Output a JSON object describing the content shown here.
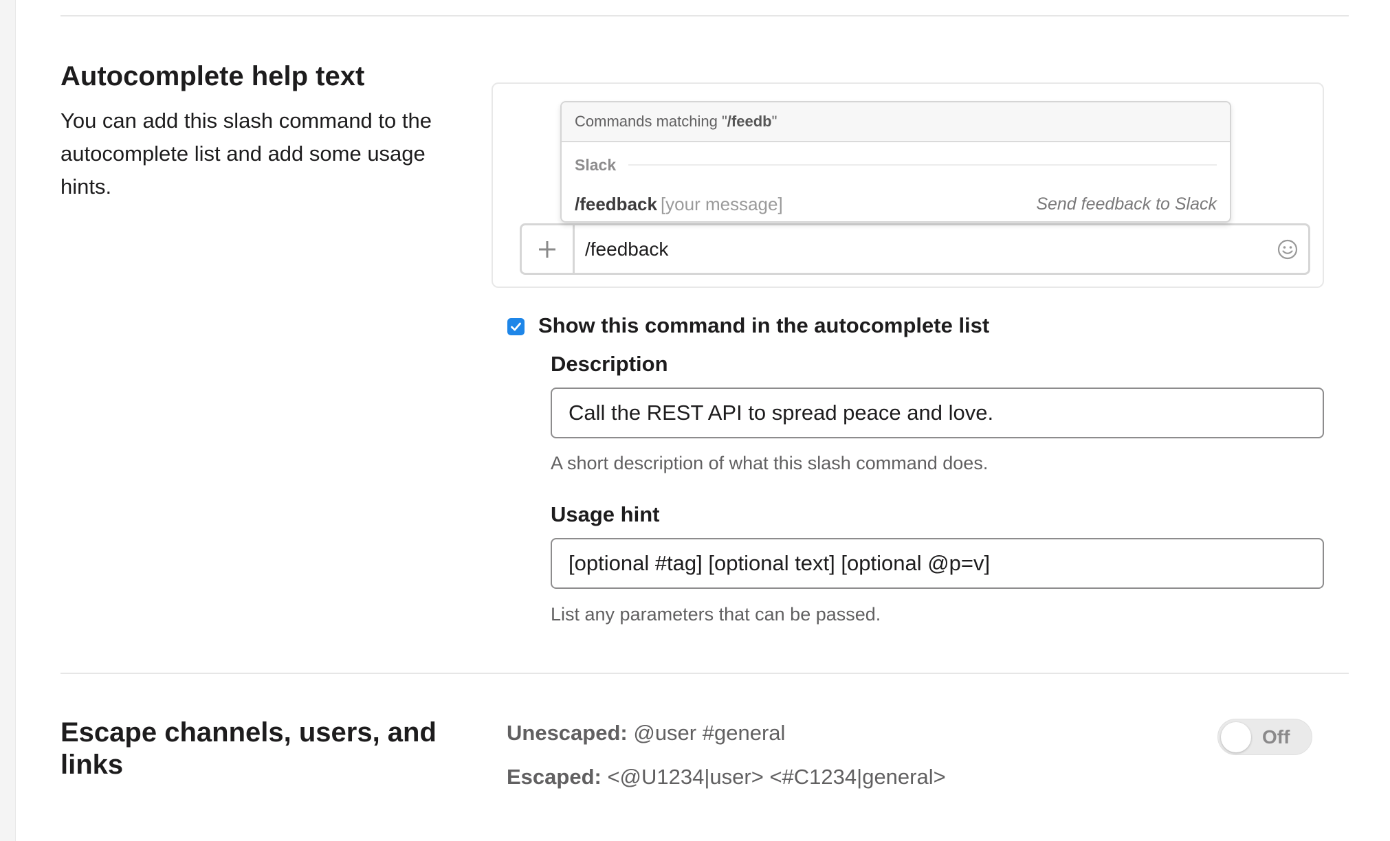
{
  "autocomplete": {
    "title": "Autocomplete help text",
    "description": "You can add this slash command to the autocomplete list and add some usage hints.",
    "preview": {
      "header_prefix": "Commands matching \"",
      "header_query": "/feedb",
      "header_suffix": "\"",
      "group_label": "Slack",
      "item_command": "/feedback",
      "item_hint": "[your message]",
      "item_description": "Send feedback to Slack",
      "composer_value": "/feedback",
      "plus_icon": "plus-icon",
      "emoji_icon": "smiley-icon"
    },
    "show_checkbox": {
      "checked": true,
      "label": "Show this command in the autocomplete list"
    },
    "description_field": {
      "label": "Description",
      "value": "Call the REST API to spread peace and love.",
      "help": "A short description of what this slash command does."
    },
    "usage_field": {
      "label": "Usage hint",
      "value": "[optional #tag] [optional text] [optional @p=v]",
      "help": "List any parameters that can be passed."
    }
  },
  "escape": {
    "title": "Escape channels, users, and links",
    "unescaped_label": "Unescaped:",
    "unescaped_value": " @user #general",
    "escaped_label": "Escaped:",
    "escaped_value": " <@U1234|user> <#C1234|general>",
    "toggle_label": "Off",
    "toggle_on": false
  },
  "colors": {
    "checkbox_accent": "#1e86e8",
    "text_primary": "#1d1c1d",
    "text_secondary": "#616061"
  }
}
